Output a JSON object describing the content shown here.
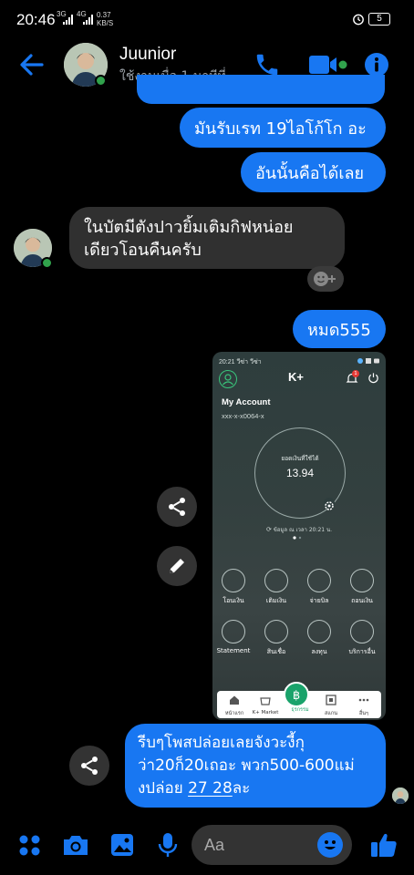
{
  "status_bar": {
    "time": "20:46",
    "sig1": "3G",
    "sig2": "4G",
    "speed_value": "0.37",
    "speed_unit": "KB/S",
    "battery": "5"
  },
  "header": {
    "contact_name": "Juunior",
    "status_text": "ใช้งานเมื่อ 1 นาทีที่...",
    "accent_color": "#1877f2",
    "icons": [
      "back-arrow-icon",
      "phone-icon",
      "video-camera-icon",
      "info-icon"
    ]
  },
  "messages": [
    {
      "from": "me",
      "text": "มันรับเรท 19ไอโก้โก อะ"
    },
    {
      "from": "me",
      "text": "อันนั้นคือได้เลย"
    },
    {
      "from": "them",
      "lines": [
        "ในบัตมีตังปาวยิ้มเติมกิฟหน่อย",
        "เดียวโอนคืนครับ"
      ]
    },
    {
      "from": "me",
      "text": "หมด555"
    },
    {
      "from": "me",
      "lines": [
        "รีบๆโพสปล่อยเลยจังวะงี้กุ",
        "ว่า20ก็20เถอะ พวก500-600แม่",
        "งปล่อย "
      ],
      "link_text": "27 28",
      "after_link": "ละ"
    }
  ],
  "shared_image": {
    "status_time": "20:21",
    "status_carrier": "วีซ่า วีซ่า",
    "app_logo": "K+",
    "notif_count": "1",
    "title": "My Account",
    "account_no": "xxx-x-x0064-x",
    "balance_label": "ยอดเงินที่ใช้ได้",
    "balance": "13.94",
    "info": "ข้อมูล ณ เวลา 20:21 น.",
    "tiles": [
      "โอนเงิน",
      "เติมเงิน",
      "จ่ายบิล",
      "ถอนเงิน",
      "Statement",
      "สินเชื่อ",
      "ลงทุน",
      "บริการอื่น"
    ],
    "nav": [
      "หน้าแรก",
      "K+ Market",
      "ธุรกรรม",
      "สแกน",
      "อื่นๆ"
    ]
  },
  "composer": {
    "placeholder": "Aa",
    "icons": [
      "apps-icon",
      "camera-icon",
      "gallery-icon",
      "microphone-icon",
      "emoji-icon",
      "thumbs-up-icon"
    ]
  }
}
